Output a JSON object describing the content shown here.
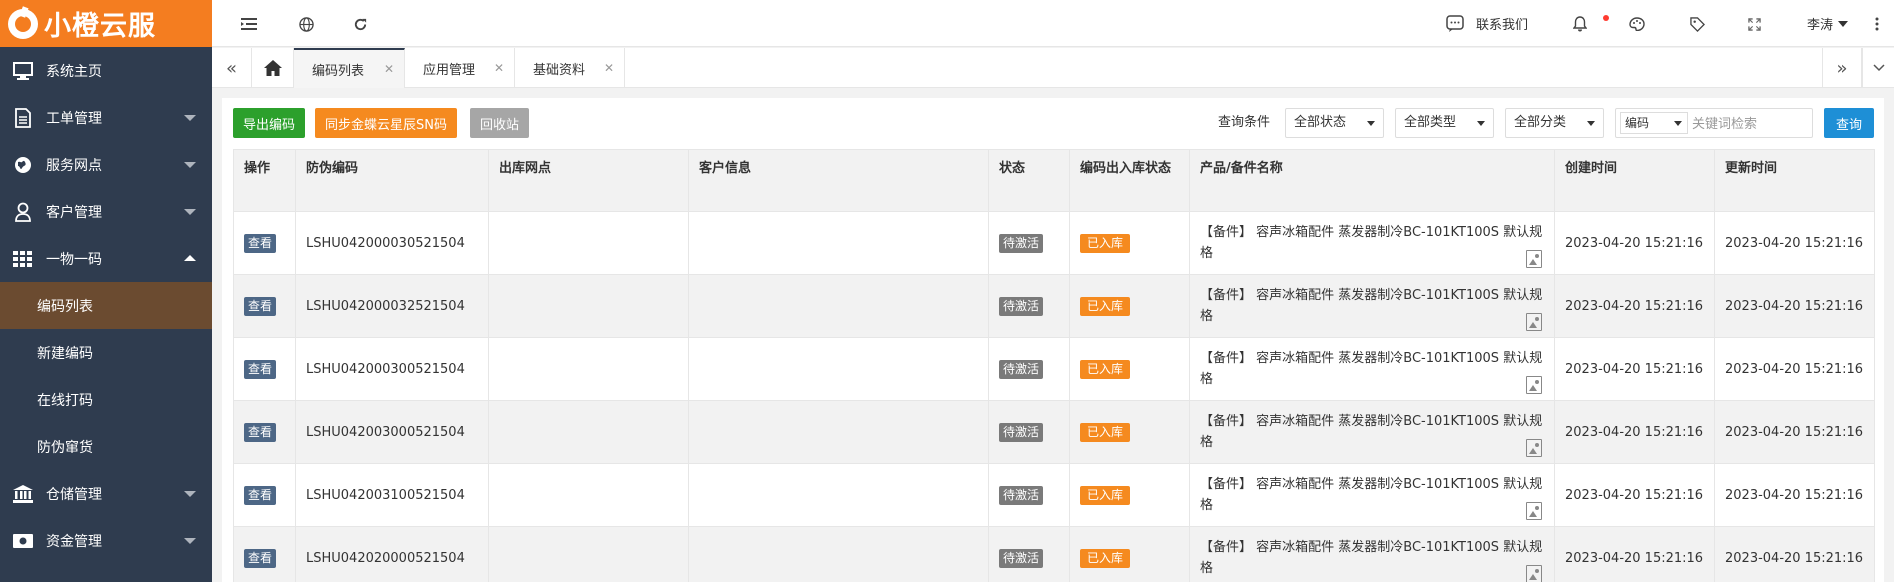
{
  "app": {
    "logo_text": "小橙云服"
  },
  "sidebar": {
    "items": [
      {
        "label": "系统主页",
        "icon": "monitor-icon",
        "has_caret": false
      },
      {
        "label": "工单管理",
        "icon": "document-icon",
        "has_caret": true
      },
      {
        "label": "服务网点",
        "icon": "globe-icon",
        "has_caret": true
      },
      {
        "label": "客户管理",
        "icon": "user-icon",
        "has_caret": true
      },
      {
        "label": "一物一码",
        "icon": "grid-icon",
        "has_caret": true,
        "expanded": true
      }
    ],
    "sub_items": [
      {
        "label": "编码列表",
        "active": true
      },
      {
        "label": "新建编码",
        "active": false
      },
      {
        "label": "在线打码",
        "active": false
      },
      {
        "label": "防伪窜货",
        "active": false
      }
    ],
    "items_after": [
      {
        "label": "仓储管理",
        "icon": "bank-icon",
        "has_caret": true
      },
      {
        "label": "资金管理",
        "icon": "money-icon",
        "has_caret": true
      }
    ]
  },
  "header": {
    "contact_label": "联系我们",
    "user_name": "李涛",
    "icons": [
      "menu-toggle-icon",
      "globe-icon",
      "refresh-icon",
      "chat-icon",
      "bell-icon",
      "palette-icon",
      "tag-icon",
      "fullscreen-icon",
      "more-icon"
    ]
  },
  "tabs": [
    {
      "label": "编码列表",
      "active": true
    },
    {
      "label": "应用管理",
      "active": false
    },
    {
      "label": "基础资料",
      "active": false
    }
  ],
  "toolbar": {
    "export_label": "导出编码",
    "sync_label": "同步金蝶云星辰SN码",
    "recycle_label": "回收站",
    "colors": {
      "export": "#2ca02c",
      "sync": "#f58a1f",
      "recycle": "#a6a6a6"
    }
  },
  "filters": {
    "label": "查询条件",
    "status": "全部状态",
    "type": "全部类型",
    "category": "全部分类",
    "search_field": "编码",
    "search_placeholder": "关键词检索",
    "query_label": "查询"
  },
  "table": {
    "columns": [
      "操作",
      "防伪编码",
      "出库网点",
      "客户信息",
      "状态",
      "编码出入库状态",
      "产品/备件名称",
      "创建时间",
      "更新时间"
    ],
    "rows": [
      {
        "action": "查看",
        "code": "LSHU042000030521504",
        "outlet": "",
        "customer": "",
        "status": "待激活",
        "stock_status": "已入库",
        "product": "【备件】 容声冰箱配件 蒸发器制冷BC-101KT100S 默认规格",
        "created": "2023-04-20 15:21:16",
        "updated": "2023-04-20 15:21:16"
      },
      {
        "action": "查看",
        "code": "LSHU042000032521504",
        "outlet": "",
        "customer": "",
        "status": "待激活",
        "stock_status": "已入库",
        "product": "【备件】 容声冰箱配件 蒸发器制冷BC-101KT100S 默认规格",
        "created": "2023-04-20 15:21:16",
        "updated": "2023-04-20 15:21:16"
      },
      {
        "action": "查看",
        "code": "LSHU042000300521504",
        "outlet": "",
        "customer": "",
        "status": "待激活",
        "stock_status": "已入库",
        "product": "【备件】 容声冰箱配件 蒸发器制冷BC-101KT100S 默认规格",
        "created": "2023-04-20 15:21:16",
        "updated": "2023-04-20 15:21:16"
      },
      {
        "action": "查看",
        "code": "LSHU042003000521504",
        "outlet": "",
        "customer": "",
        "status": "待激活",
        "stock_status": "已入库",
        "product": "【备件】 容声冰箱配件 蒸发器制冷BC-101KT100S 默认规格",
        "created": "2023-04-20 15:21:16",
        "updated": "2023-04-20 15:21:16"
      },
      {
        "action": "查看",
        "code": "LSHU042003100521504",
        "outlet": "",
        "customer": "",
        "status": "待激活",
        "stock_status": "已入库",
        "product": "【备件】 容声冰箱配件 蒸发器制冷BC-101KT100S 默认规格",
        "created": "2023-04-20 15:21:16",
        "updated": "2023-04-20 15:21:16"
      },
      {
        "action": "查看",
        "code": "LSHU042020000521504",
        "outlet": "",
        "customer": "",
        "status": "待激活",
        "stock_status": "已入库",
        "product": "【备件】 容声冰箱配件 蒸发器制冷BC-101KT100S 默认规格",
        "created": "2023-04-20 15:21:16",
        "updated": "2023-04-20 15:21:16"
      }
    ]
  }
}
